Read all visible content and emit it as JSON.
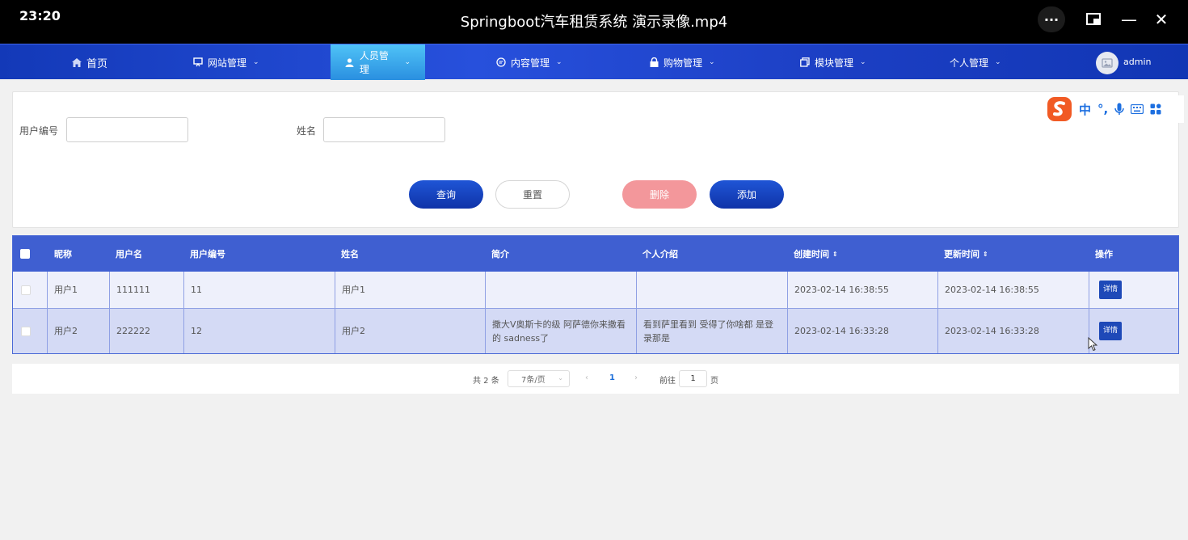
{
  "player": {
    "time": "23:20",
    "title": "Springboot汽车租赁系统 演示录像.mp4",
    "more_label": "···",
    "min_label": "—",
    "close_label": "✕"
  },
  "nav": {
    "items": [
      {
        "label": "首页",
        "icon": "home-icon"
      },
      {
        "label": "网站管理",
        "icon": "monitor-icon"
      },
      {
        "label": "人员管理",
        "icon": "user-icon"
      },
      {
        "label": "内容管理",
        "icon": "chat-icon"
      },
      {
        "label": "购物管理",
        "icon": "lock-icon"
      },
      {
        "label": "模块管理",
        "icon": "copy-icon"
      },
      {
        "label": "个人管理",
        "icon": ""
      }
    ],
    "active_index": 2,
    "username": "admin"
  },
  "search": {
    "user_no_label": "用户编号",
    "user_no_value": "",
    "name_label": "姓名",
    "name_value": "",
    "query_label": "查询",
    "reset_label": "重置",
    "delete_label": "删除",
    "add_label": "添加"
  },
  "ime": {
    "labels": [
      "中",
      "°,"
    ]
  },
  "table": {
    "headers": [
      "昵称",
      "用户名",
      "用户编号",
      "姓名",
      "简介",
      "个人介绍",
      "创建时间",
      "更新时间",
      "操作"
    ],
    "sort_icon": "⇕",
    "rows": [
      {
        "nickname": "用户1",
        "username": "111111",
        "user_no": "11",
        "name": "用户1",
        "intro": "",
        "profile": "",
        "created": "2023-02-14 16:38:55",
        "updated": "2023-02-14 16:38:55",
        "action": "详情"
      },
      {
        "nickname": "用户2",
        "username": "222222",
        "user_no": "12",
        "name": "用户2",
        "intro": "撒大V奥斯卡的级 阿萨德你来撒看的 sadness了",
        "profile": "看到萨里看到 受得了你啥都 是登录那是",
        "created": "2023-02-14 16:33:28",
        "updated": "2023-02-14 16:33:28",
        "action": "详情"
      }
    ]
  },
  "pagination": {
    "total": "共 2 条",
    "page_size": "7条/页",
    "current_page": "1",
    "goto_label": "前往",
    "goto_value": "1",
    "page_suffix": "页"
  },
  "colors": {
    "nav_bg": "#1c3fc4",
    "primary": "#1a47c8",
    "danger_light": "#f3979b",
    "header_bg": "#3f5fd1"
  }
}
